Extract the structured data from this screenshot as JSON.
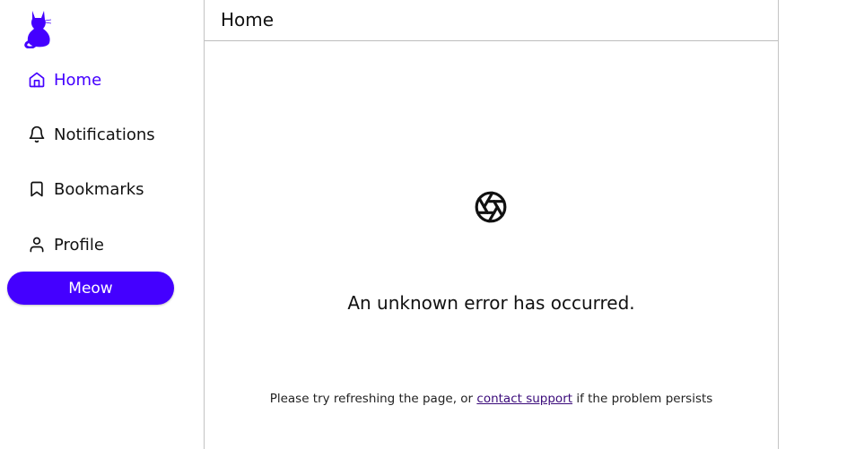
{
  "theme": {
    "accent": "#4400ff"
  },
  "sidebar": {
    "logo": "cat-logo-icon",
    "items": [
      {
        "label": "Home",
        "icon": "home-icon",
        "active": true
      },
      {
        "label": "Notifications",
        "icon": "bell-icon",
        "active": false
      },
      {
        "label": "Bookmarks",
        "icon": "bookmark-icon",
        "active": false
      },
      {
        "label": "Profile",
        "icon": "user-icon",
        "active": false
      }
    ],
    "post_button_label": "Meow"
  },
  "main": {
    "title": "Home",
    "error": {
      "icon": "aperture-icon",
      "message": "An unknown error has occurred.",
      "help_before": "Please try refreshing the page, or ",
      "help_link": "contact support",
      "help_after": " if the problem persists"
    }
  }
}
